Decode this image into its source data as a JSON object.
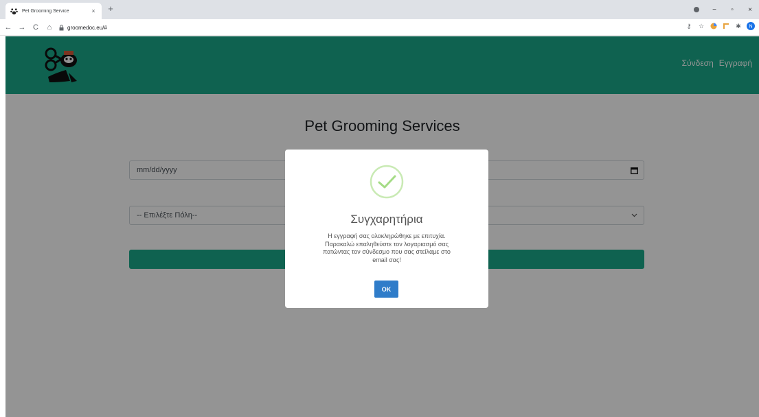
{
  "browser": {
    "tab_title": "Pet Grooming Service",
    "tab_close": "×",
    "new_tab": "+",
    "url": "groomedoc.eu/#",
    "window_minimize": "−",
    "window_maximize": "▫",
    "window_close": "×"
  },
  "header": {
    "nav": {
      "login": "Σύνδεση",
      "register": "Εγγραφή"
    },
    "brand_color": "#1aaa8a"
  },
  "main": {
    "title": "Pet Grooming Services",
    "date_placeholder": "mm/dd/yyyy",
    "city_select_value": "-- Επιλέξτε Πόλη--"
  },
  "modal": {
    "title": "Συγχαρητήρια",
    "message_lines": [
      "Η εγγραφή σας ολοκληρώθηκε με επιτυχία.",
      "Παρακαλώ επαληθεύστε τον λογαριασμό σας",
      "πατώντας τον σύνδεσμο που σας στείλαμε στο",
      "email σας!"
    ],
    "ok_label": "OK",
    "success_color": "#a5dc86",
    "button_color": "#2f7cc9"
  }
}
